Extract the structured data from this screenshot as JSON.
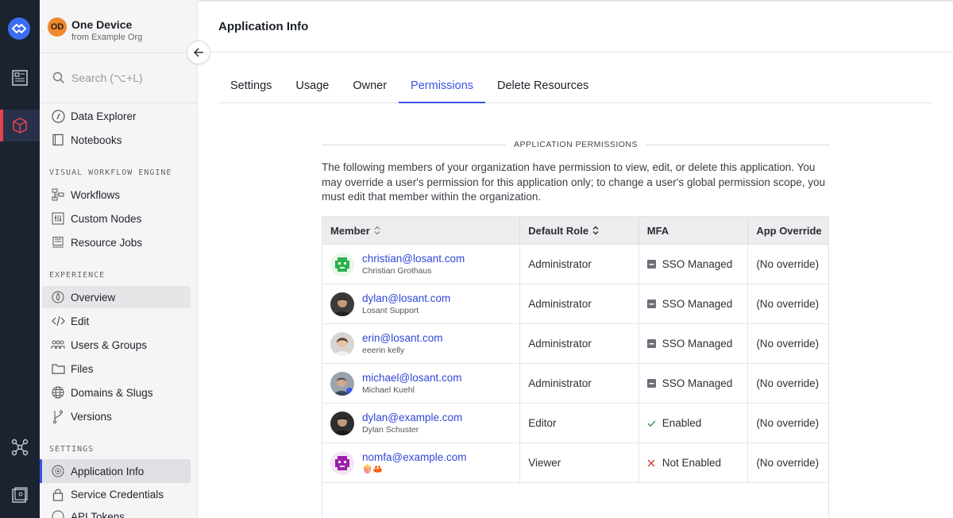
{
  "device": {
    "initials": "OD",
    "name": "One Device",
    "org": "from Example Org"
  },
  "search": {
    "placeholder": "Search (⌥+L)"
  },
  "nav": {
    "data_explorer": "Data Explorer",
    "notebooks": "Notebooks",
    "section_workflow": "VISUAL WORKFLOW ENGINE",
    "workflows": "Workflows",
    "custom_nodes": "Custom Nodes",
    "resource_jobs": "Resource Jobs",
    "section_experience": "EXPERIENCE",
    "overview": "Overview",
    "edit": "Edit",
    "users_groups": "Users & Groups",
    "files": "Files",
    "domains_slugs": "Domains & Slugs",
    "versions": "Versions",
    "section_settings": "SETTINGS",
    "application_info": "Application Info",
    "service_credentials": "Service Credentials",
    "api_tokens": "API Tokens"
  },
  "header": {
    "title": "Application Info"
  },
  "tabs": [
    "Settings",
    "Usage",
    "Owner",
    "Permissions",
    "Delete Resources"
  ],
  "permissions": {
    "heading": "APPLICATION PERMISSIONS",
    "description": "The following members of your organization have permission to view, edit, or delete this application. You may override a user's permission for this application only; to change a user's global permission scope, you must edit that member within the organization.",
    "columns": [
      "Member",
      "Default Role",
      "MFA",
      "App Override"
    ],
    "rows": [
      {
        "email": "christian@losant.com",
        "name": "Christian Grothaus",
        "role": "Administrator",
        "mfa": "SSO Managed",
        "mfa_icon": "minus-square-icon",
        "override": "(No override)"
      },
      {
        "email": "dylan@losant.com",
        "name": "Losant Support",
        "role": "Administrator",
        "mfa": "SSO Managed",
        "mfa_icon": "minus-square-icon",
        "override": "(No override)"
      },
      {
        "email": "erin@losant.com",
        "name": "eeerin kelly",
        "role": "Administrator",
        "mfa": "SSO Managed",
        "mfa_icon": "minus-square-icon",
        "override": "(No override)"
      },
      {
        "email": "michael@losant.com",
        "name": "Michael Kuehl",
        "role": "Administrator",
        "mfa": "SSO Managed",
        "mfa_icon": "minus-square-icon",
        "override": "(No override)"
      },
      {
        "email": "dylan@example.com",
        "name": "Dylan Schuster",
        "role": "Editor",
        "mfa": "Enabled",
        "mfa_icon": "check-icon",
        "override": "(No override)"
      },
      {
        "email": "nomfa@example.com",
        "name": "🍿🦀",
        "role": "Viewer",
        "mfa": "Not Enabled",
        "mfa_icon": "x-icon",
        "override": "(No override)"
      }
    ]
  },
  "colors": {
    "accent": "#3b52e8",
    "rail": "#1b2331",
    "rail_active": "#e8414f",
    "device_badge": "#f1882c"
  }
}
